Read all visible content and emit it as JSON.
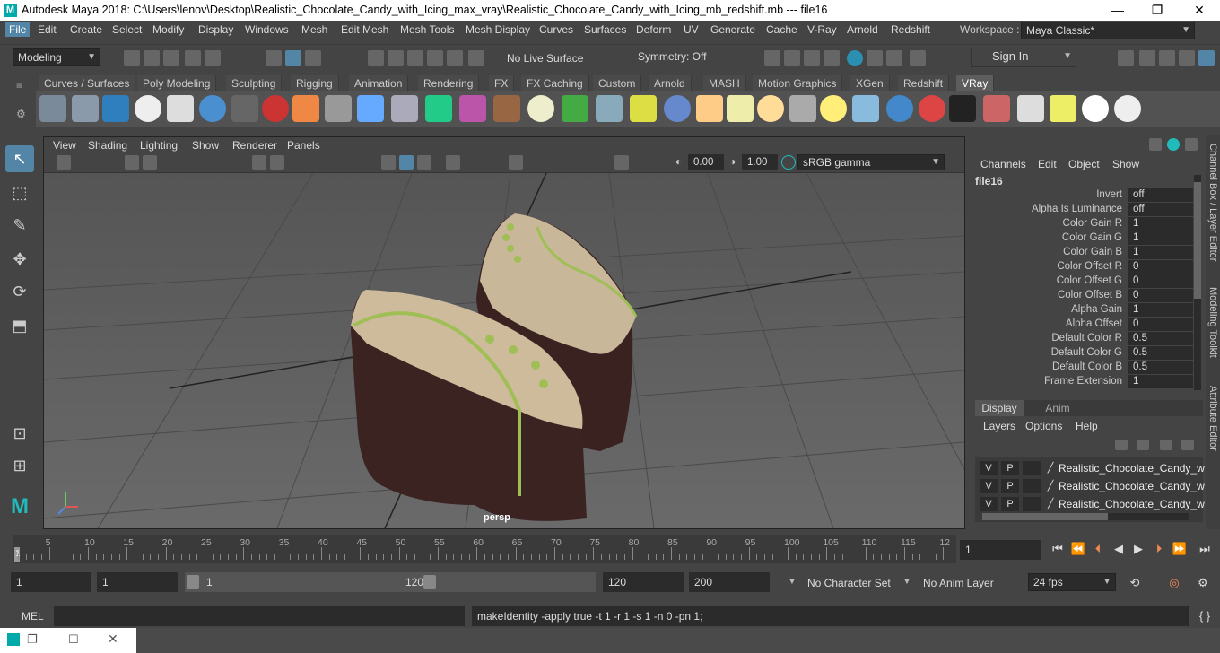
{
  "window": {
    "title": "Autodesk Maya 2018: C:\\Users\\lenov\\Desktop\\Realistic_Chocolate_Candy_with_Icing_max_vray\\Realistic_Chocolate_Candy_with_Icing_mb_redshift.mb   ---   file16",
    "logo": "M",
    "min_icon": "—",
    "max_icon": "❐",
    "close_icon": "✕"
  },
  "menu": [
    "File",
    "Edit",
    "Create",
    "Select",
    "Modify",
    "Display",
    "Windows",
    "Mesh",
    "Edit Mesh",
    "Mesh Tools",
    "Mesh Display",
    "Curves",
    "Surfaces",
    "Deform",
    "UV",
    "Generate",
    "Cache",
    "V-Ray",
    "Arnold",
    "Redshift"
  ],
  "workspace": {
    "label": "Workspace :",
    "value": "Maya Classic*"
  },
  "status": {
    "mode": "Modeling",
    "live_surface": "No Live Surface",
    "symmetry": "Symmetry: Off",
    "sign_in": "Sign In"
  },
  "shelf_tabs": [
    "Curves / Surfaces",
    "Poly Modeling",
    "Sculpting",
    "Rigging",
    "Animation",
    "Rendering",
    "FX",
    "FX Caching",
    "Custom",
    "Arnold",
    "MASH",
    "Motion Graphics",
    "XGen",
    "Redshift",
    "VRay"
  ],
  "shelf_active": "VRay",
  "viewport": {
    "menu": [
      "View",
      "Shading",
      "Lighting",
      "Show",
      "Renderer",
      "Panels"
    ],
    "exposure": "0.00",
    "gamma": "1.00",
    "colorspace": "sRGB gamma",
    "camera": "persp"
  },
  "channel_box": {
    "menu": [
      "Channels",
      "Edit",
      "Object",
      "Show"
    ],
    "node": "file16",
    "rows": [
      {
        "label": "Invert",
        "value": "off"
      },
      {
        "label": "Alpha Is Luminance",
        "value": "off"
      },
      {
        "label": "Color Gain R",
        "value": "1"
      },
      {
        "label": "Color Gain G",
        "value": "1"
      },
      {
        "label": "Color Gain B",
        "value": "1"
      },
      {
        "label": "Color Offset R",
        "value": "0"
      },
      {
        "label": "Color Offset G",
        "value": "0"
      },
      {
        "label": "Color Offset B",
        "value": "0"
      },
      {
        "label": "Alpha Gain",
        "value": "1"
      },
      {
        "label": "Alpha Offset",
        "value": "0"
      },
      {
        "label": "Default Color R",
        "value": "0.5"
      },
      {
        "label": "Default Color G",
        "value": "0.5"
      },
      {
        "label": "Default Color B",
        "value": "0.5"
      },
      {
        "label": "Frame Extension",
        "value": "1"
      }
    ]
  },
  "side_tabs": [
    "Channel Box / Layer Editor",
    "Modeling Toolkit",
    "Attribute Editor"
  ],
  "layer_editor": {
    "tabs": [
      "Display",
      "Anim"
    ],
    "menu": [
      "Layers",
      "Options",
      "Help"
    ],
    "rows": [
      {
        "v": "V",
        "p": "P",
        "name": "Realistic_Chocolate_Candy_w"
      },
      {
        "v": "V",
        "p": "P",
        "name": "Realistic_Chocolate_Candy_w"
      },
      {
        "v": "V",
        "p": "P",
        "name": "Realistic_Chocolate_Candy_w"
      }
    ]
  },
  "timeline": {
    "ticks": [
      "5",
      "10",
      "15",
      "20",
      "25",
      "30",
      "35",
      "40",
      "45",
      "50",
      "55",
      "60",
      "65",
      "70",
      "75",
      "80",
      "85",
      "90",
      "95",
      "100",
      "105",
      "110",
      "115",
      "12"
    ],
    "start_marker": "1",
    "current_frame": "1"
  },
  "range": {
    "start": "1",
    "playback_start": "1",
    "slider_start": "1",
    "slider_end": "120",
    "playback_end": "120",
    "end": "200",
    "character_set": "No Character Set",
    "anim_layer": "No Anim Layer",
    "fps": "24 fps"
  },
  "command": {
    "label": "MEL",
    "result": "makeIdentity -apply true -t 1 -r 1 -s 1 -n 0 -pn 1;"
  }
}
